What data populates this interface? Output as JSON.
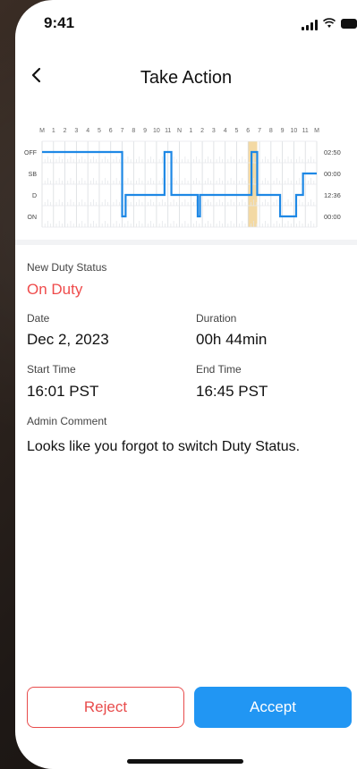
{
  "status_bar": {
    "time": "9:41"
  },
  "nav": {
    "title": "Take Action"
  },
  "chart": {
    "hour_labels": [
      "M",
      "1",
      "2",
      "3",
      "4",
      "5",
      "6",
      "7",
      "8",
      "9",
      "10",
      "11",
      "N",
      "1",
      "2",
      "3",
      "4",
      "5",
      "6",
      "7",
      "8",
      "9",
      "10",
      "11",
      "M"
    ],
    "row_labels": [
      "OFF",
      "SB",
      "D",
      "ON"
    ],
    "totals": [
      "02:50",
      "00:00",
      "12:36",
      "00:00"
    ],
    "line_color": "#1e88e5",
    "highlight_color": "#f3d9a4"
  },
  "chart_data": {
    "type": "line",
    "x_range_hours": [
      0,
      24
    ],
    "y_categories": [
      "OFF",
      "SB",
      "D",
      "ON"
    ],
    "segments": [
      {
        "from": 0,
        "to": 7.0,
        "status": "OFF"
      },
      {
        "from": 7.0,
        "to": 7.3,
        "status": "ON"
      },
      {
        "from": 7.3,
        "to": 10.7,
        "status": "D"
      },
      {
        "from": 10.7,
        "to": 11.3,
        "status": "OFF"
      },
      {
        "from": 11.3,
        "to": 13.6,
        "status": "D"
      },
      {
        "from": 13.6,
        "to": 13.8,
        "status": "ON"
      },
      {
        "from": 13.8,
        "to": 18.3,
        "status": "D"
      },
      {
        "from": 18.3,
        "to": 18.8,
        "status": "OFF"
      },
      {
        "from": 18.8,
        "to": 20.8,
        "status": "D"
      },
      {
        "from": 20.8,
        "to": 22.2,
        "status": "ON"
      },
      {
        "from": 22.2,
        "to": 22.8,
        "status": "D"
      },
      {
        "from": 22.8,
        "to": 24.0,
        "status": "SB"
      }
    ],
    "highlight_hours": [
      18.0,
      18.8
    ]
  },
  "details": {
    "new_status_label": "New Duty Status",
    "new_status_value": "On Duty",
    "date_label": "Date",
    "date_value": "Dec 2, 2023",
    "duration_label": "Duration",
    "duration_value": "00h 44min",
    "start_label": "Start Time",
    "start_value": "16:01 PST",
    "end_label": "End Time",
    "end_value": "16:45 PST",
    "comment_label": "Admin Comment",
    "comment_value": "Looks like you forgot to switch Duty Status."
  },
  "actions": {
    "reject": "Reject",
    "accept": "Accept"
  },
  "colors": {
    "accent": "#2196f3",
    "danger": "#e84b4b"
  }
}
